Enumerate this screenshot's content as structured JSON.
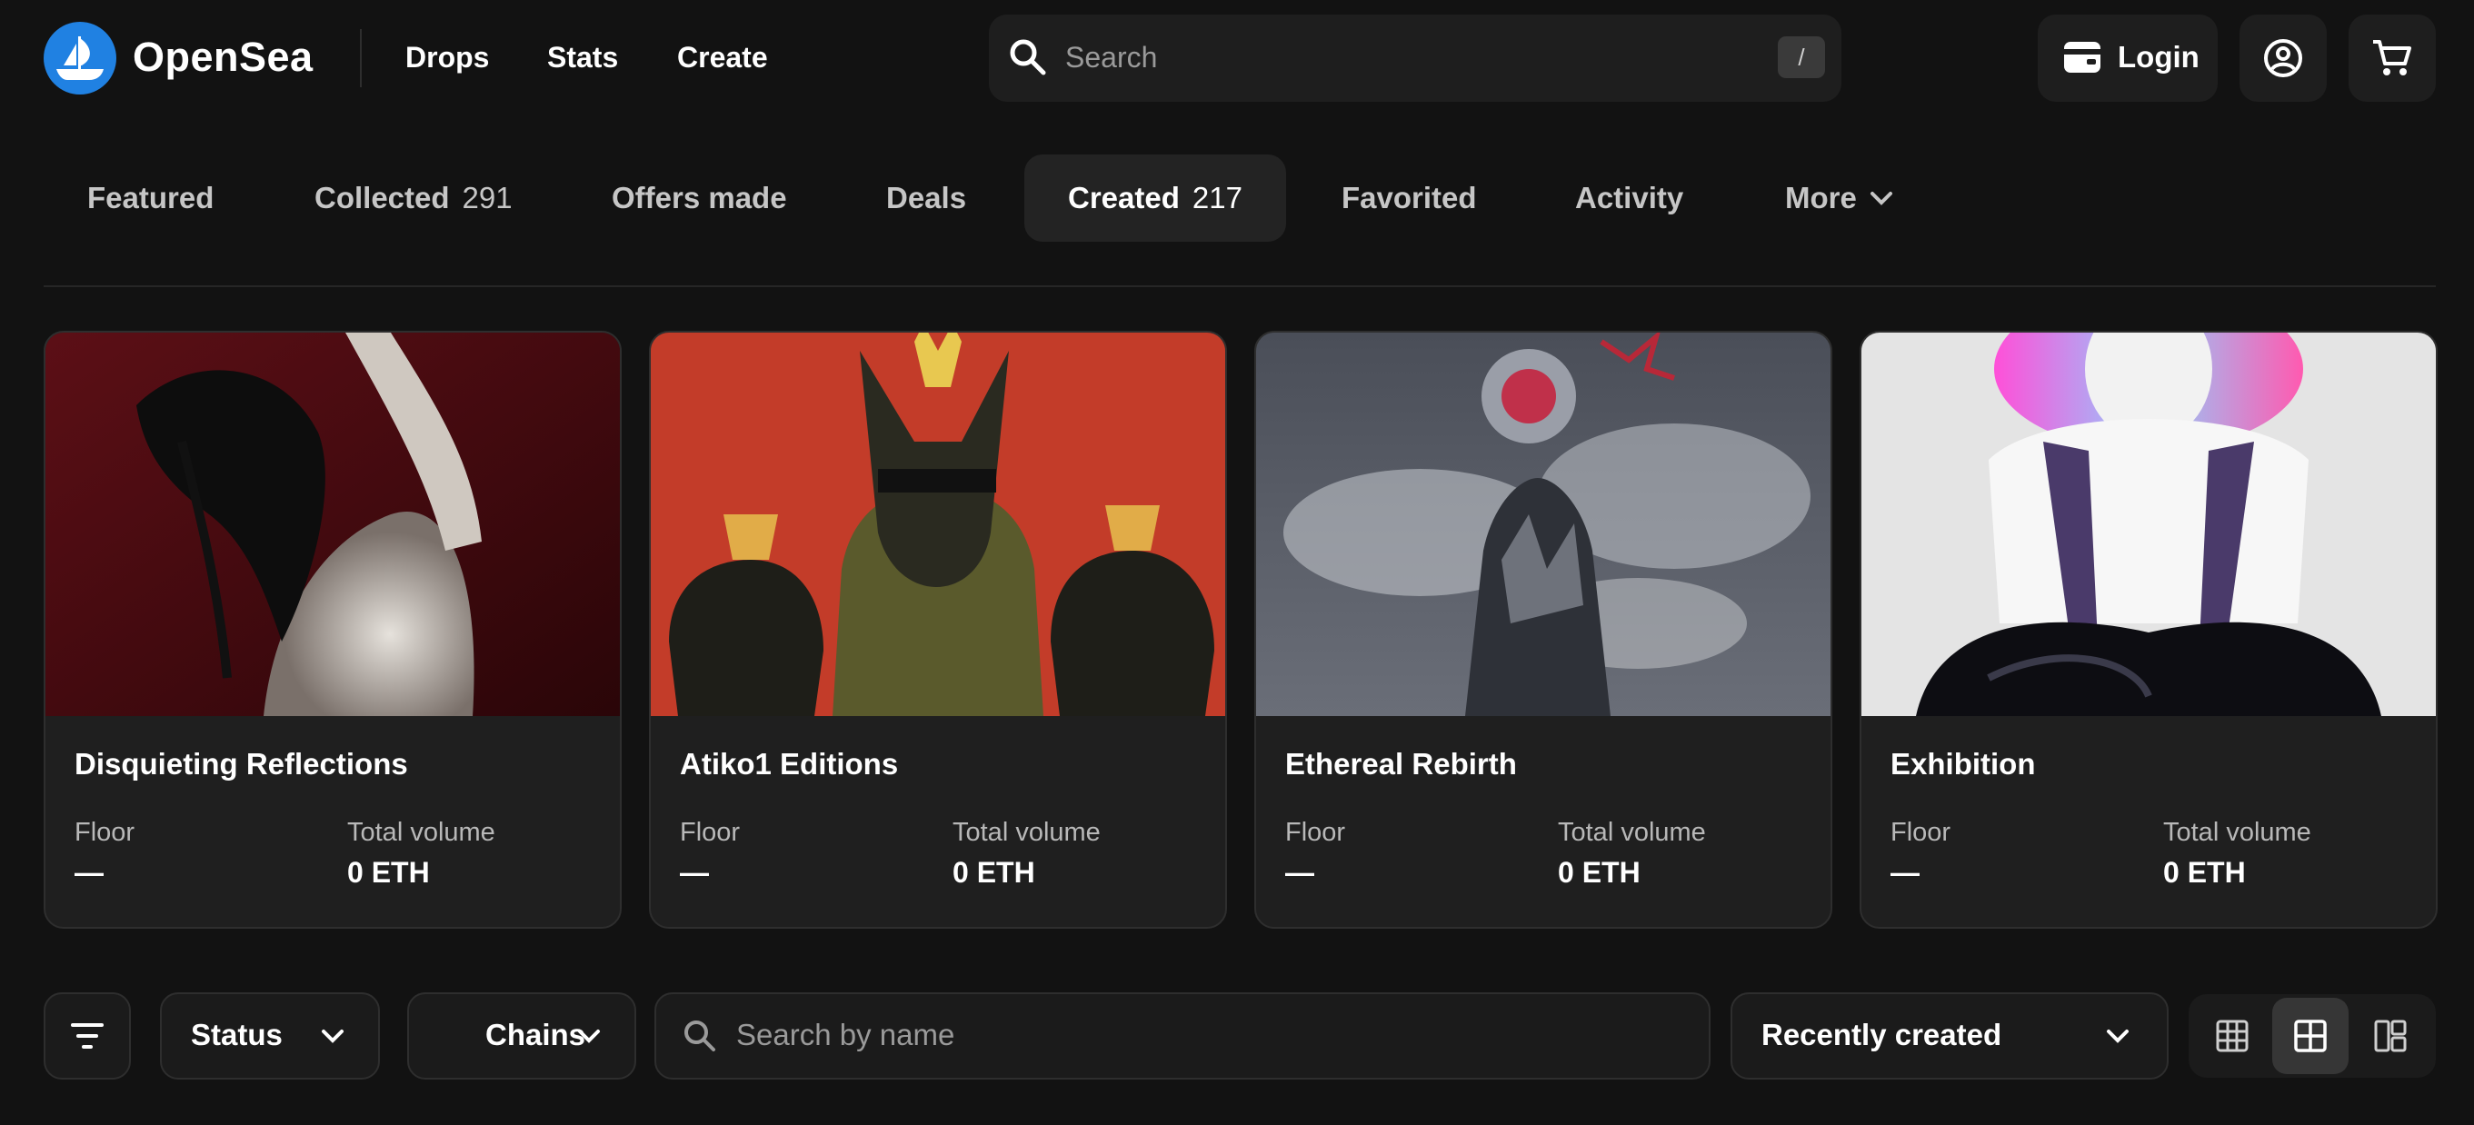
{
  "header": {
    "brand": "OpenSea",
    "nav": [
      "Drops",
      "Stats",
      "Create"
    ],
    "search_placeholder": "Search",
    "search_shortcut": "/",
    "login_label": "Login",
    "icons": [
      "opensea-logo-icon",
      "search-icon",
      "wallet-icon",
      "profile-icon",
      "cart-icon"
    ]
  },
  "tabs": [
    {
      "label": "Featured",
      "count": ""
    },
    {
      "label": "Collected",
      "count": "291"
    },
    {
      "label": "Offers made",
      "count": ""
    },
    {
      "label": "Deals",
      "count": ""
    },
    {
      "label": "Created",
      "count": "217",
      "active": true
    },
    {
      "label": "Favorited",
      "count": ""
    },
    {
      "label": "Activity",
      "count": ""
    },
    {
      "label": "More",
      "count": ""
    }
  ],
  "collections": [
    {
      "title": "Disquieting Reflections",
      "floor_label": "Floor",
      "floor": "—",
      "volume_label": "Total volume",
      "volume": "0 ETH"
    },
    {
      "title": "Atiko1 Editions",
      "floor_label": "Floor",
      "floor": "—",
      "volume_label": "Total volume",
      "volume": "0 ETH"
    },
    {
      "title": "Ethereal Rebirth",
      "floor_label": "Floor",
      "floor": "—",
      "volume_label": "Total volume",
      "volume": "0 ETH"
    },
    {
      "title": "Exhibition",
      "floor_label": "Floor",
      "floor": "—",
      "volume_label": "Total volume",
      "volume": "0 ETH"
    }
  ],
  "filters": {
    "status_label": "Status",
    "chains_label": "Chains",
    "name_search_placeholder": "Search by name",
    "sort_label": "Recently created",
    "view_modes": [
      "grid-small-icon",
      "grid-medium-icon",
      "grid-large-icon"
    ],
    "active_view": "grid-medium-icon"
  },
  "colors": {
    "background": "#121212",
    "surface": "#1f1f1f",
    "brand_blue": "#2081e2",
    "muted_text": "#b8b8b8"
  }
}
